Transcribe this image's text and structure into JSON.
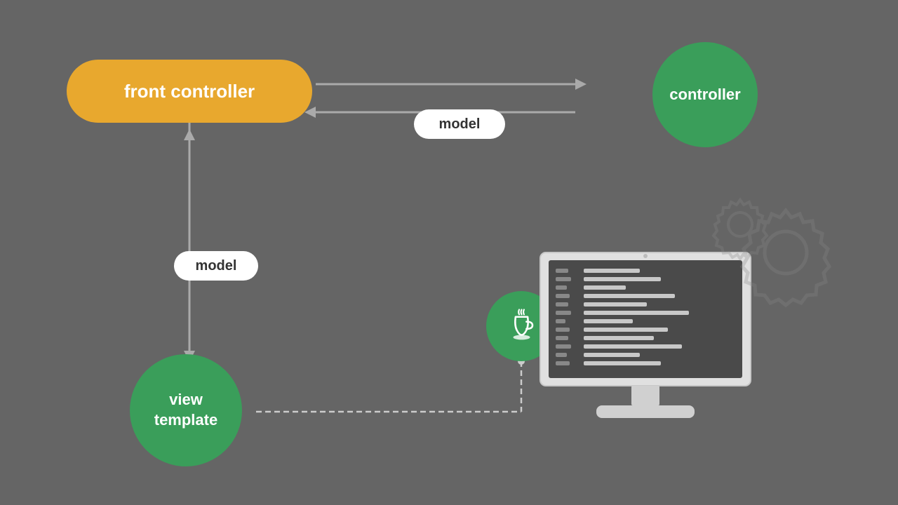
{
  "diagram": {
    "background_color": "#656565",
    "nodes": {
      "front_controller": {
        "label": "front controller",
        "color": "#E8A82E",
        "text_color": "#ffffff"
      },
      "controller": {
        "label": "controller",
        "color": "#3A9E5A",
        "text_color": "#ffffff"
      },
      "view_template": {
        "label": "view\ntemplate",
        "label_line1": "view",
        "label_line2": "template",
        "color": "#3A9E5A",
        "text_color": "#ffffff"
      },
      "model_h": {
        "label": "model",
        "color": "#ffffff",
        "text_color": "#333333"
      },
      "model_v": {
        "label": "model",
        "color": "#ffffff",
        "text_color": "#333333"
      },
      "java": {
        "label": "☕",
        "color": "#3A9E5A"
      }
    },
    "arrows": {
      "fc_to_ctrl": "right arrow from front controller to controller",
      "ctrl_to_fc": "left arrow with model label",
      "fc_to_vt": "down arrow with model label",
      "vt_to_java": "dashed line from view template to java"
    }
  }
}
